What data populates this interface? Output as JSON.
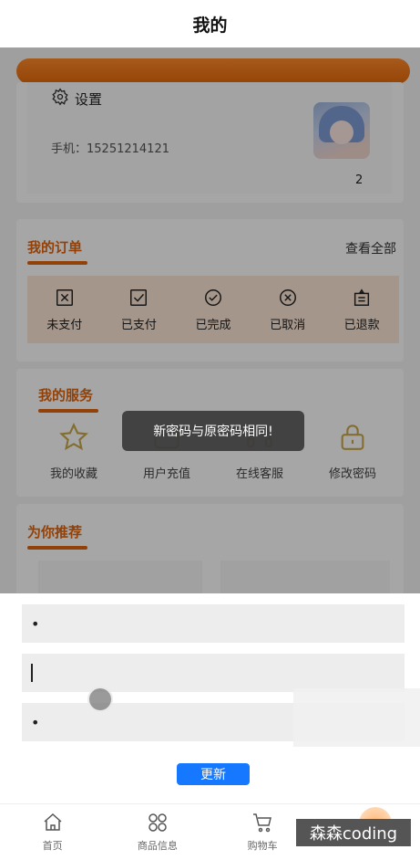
{
  "header": {
    "title": "我的"
  },
  "user": {
    "settings_label": "设置",
    "phone": "手机：15251214121",
    "badge": "2"
  },
  "orders": {
    "title": "我的订单",
    "see_all": "查看全部",
    "items": [
      {
        "label": "未支付",
        "icon": "unpaid-icon"
      },
      {
        "label": "已支付",
        "icon": "paid-icon"
      },
      {
        "label": "已完成",
        "icon": "completed-icon"
      },
      {
        "label": "已取消",
        "icon": "cancelled-icon"
      },
      {
        "label": "已退款",
        "icon": "refunded-icon"
      }
    ]
  },
  "services": {
    "title": "我的服务",
    "items": [
      {
        "label": "我的收藏",
        "icon": "star-icon"
      },
      {
        "label": "用户充值",
        "icon": "wallet-icon"
      },
      {
        "label": "在线客服",
        "icon": "headset-icon"
      },
      {
        "label": "修改密码",
        "icon": "lock-icon"
      }
    ]
  },
  "recommend": {
    "title": "为你推荐"
  },
  "toast": {
    "message": "新密码与原密码相同!"
  },
  "password_form": {
    "field1_value": "•",
    "field3_value": "•",
    "update_label": "更新"
  },
  "tabbar": {
    "items": [
      {
        "label": "首页",
        "icon": "home-icon"
      },
      {
        "label": "商品信息",
        "icon": "grid-icon"
      },
      {
        "label": "购物车",
        "icon": "cart-icon"
      }
    ]
  },
  "watermark": "森森coding",
  "colors": {
    "accent": "#e0650e",
    "button": "#1677ff",
    "order_bg": "#fde6d6"
  }
}
